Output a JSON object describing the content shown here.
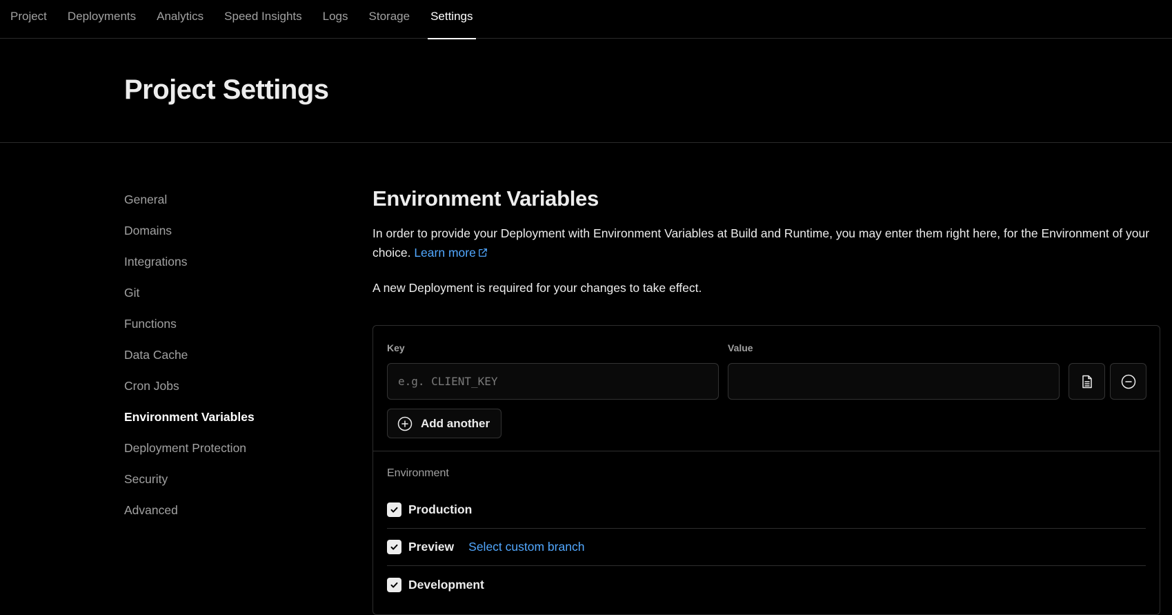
{
  "nav": {
    "tabs": [
      {
        "label": "Project"
      },
      {
        "label": "Deployments"
      },
      {
        "label": "Analytics"
      },
      {
        "label": "Speed Insights"
      },
      {
        "label": "Logs"
      },
      {
        "label": "Storage"
      },
      {
        "label": "Settings",
        "active": true
      }
    ]
  },
  "header": {
    "title": "Project Settings"
  },
  "sidebar": {
    "items": [
      {
        "label": "General"
      },
      {
        "label": "Domains"
      },
      {
        "label": "Integrations"
      },
      {
        "label": "Git"
      },
      {
        "label": "Functions"
      },
      {
        "label": "Data Cache"
      },
      {
        "label": "Cron Jobs"
      },
      {
        "label": "Environment Variables",
        "active": true
      },
      {
        "label": "Deployment Protection"
      },
      {
        "label": "Security"
      },
      {
        "label": "Advanced"
      }
    ]
  },
  "main": {
    "title": "Environment Variables",
    "description": "In order to provide your Deployment with Environment Variables at Build and Runtime, you may enter them right here, for the Environment of your choice.",
    "learn_more": "Learn more",
    "notice": "A new Deployment is required for your changes to take effect.",
    "form": {
      "key_label": "Key",
      "key_placeholder": "e.g. CLIENT_KEY",
      "key_value": "",
      "value_label": "Value",
      "value_value": "",
      "add_another": "Add another",
      "environment_label": "Environment",
      "environments": [
        {
          "label": "Production",
          "checked": true
        },
        {
          "label": "Preview",
          "checked": true,
          "link": "Select custom branch"
        },
        {
          "label": "Development",
          "checked": true
        }
      ]
    }
  },
  "colors": {
    "background": "#000000",
    "link": "#52a8ff",
    "border": "#2e2e2e",
    "muted_text": "#a1a1a1"
  }
}
